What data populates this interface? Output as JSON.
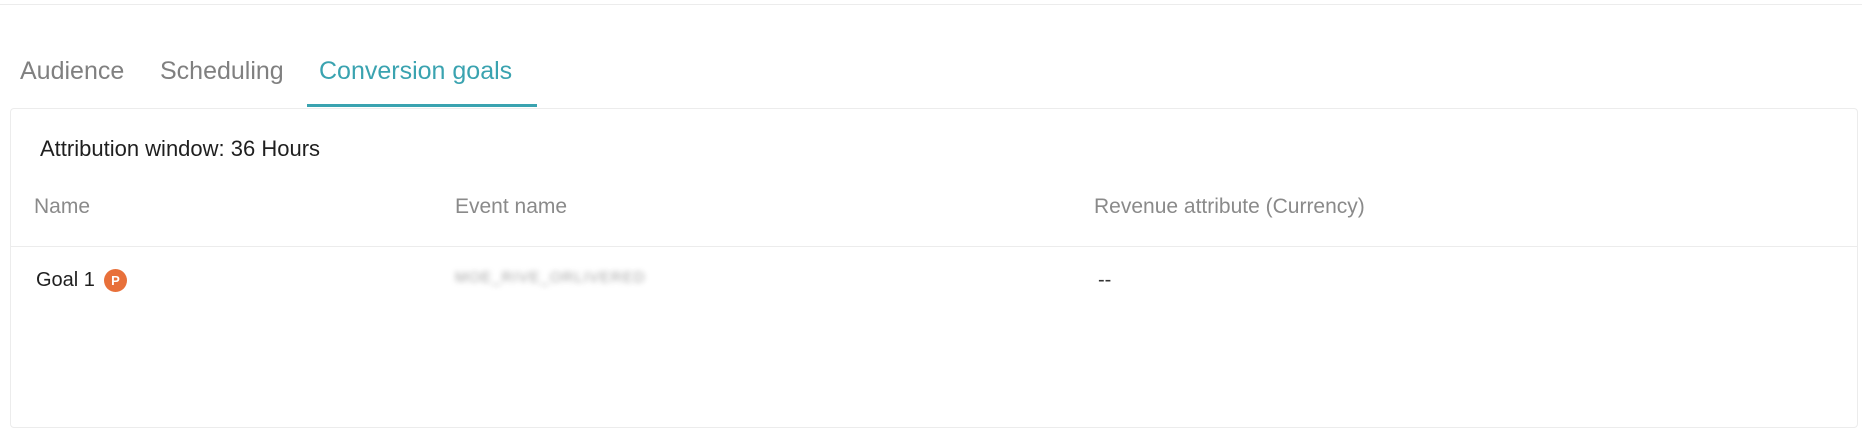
{
  "tabs": [
    {
      "label": "Audience",
      "active": false
    },
    {
      "label": "Scheduling",
      "active": false
    },
    {
      "label": "Conversion goals",
      "active": true
    }
  ],
  "colors": {
    "accent": "#3aa3b0",
    "badge": "#e8703a",
    "muted_text": "#808080"
  },
  "panel": {
    "attribution_window": "Attribution window: 36 Hours",
    "columns": {
      "name": "Name",
      "event": "Event name",
      "revenue": "Revenue attribute (Currency)"
    },
    "rows": [
      {
        "name": "Goal 1",
        "badge": "P",
        "event": "MOE_RIVE_ORLIVERED",
        "revenue": "--"
      }
    ]
  }
}
